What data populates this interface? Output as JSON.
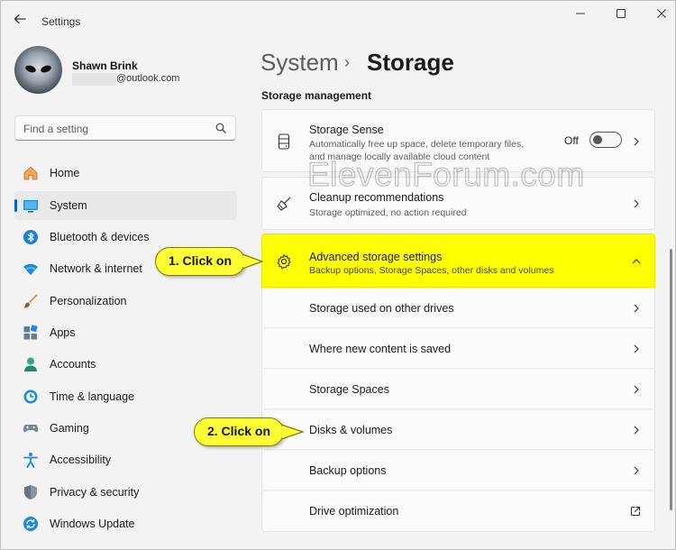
{
  "app": {
    "title": "Settings"
  },
  "window_controls": {
    "minimize": "—",
    "maximize": "☐",
    "close": "✕"
  },
  "user": {
    "name": "Shawn Brink",
    "email": "@outlook.com"
  },
  "search": {
    "placeholder": "Find a setting"
  },
  "nav": [
    {
      "label": "Home",
      "icon": "home-icon"
    },
    {
      "label": "System",
      "icon": "system-icon",
      "active": true
    },
    {
      "label": "Bluetooth & devices",
      "icon": "bluetooth-icon"
    },
    {
      "label": "Network & internet",
      "icon": "wifi-icon"
    },
    {
      "label": "Personalization",
      "icon": "brush-icon"
    },
    {
      "label": "Apps",
      "icon": "apps-icon"
    },
    {
      "label": "Accounts",
      "icon": "accounts-icon"
    },
    {
      "label": "Time & language",
      "icon": "clock-globe-icon"
    },
    {
      "label": "Gaming",
      "icon": "gamepad-icon"
    },
    {
      "label": "Accessibility",
      "icon": "accessibility-icon"
    },
    {
      "label": "Privacy & security",
      "icon": "shield-icon"
    },
    {
      "label": "Windows Update",
      "icon": "update-icon"
    }
  ],
  "breadcrumb": {
    "root": "System",
    "separator": "›",
    "current": "Storage"
  },
  "section_title": "Storage management",
  "storage_sense": {
    "title": "Storage Sense",
    "desc_line1": "Automatically free up space, delete temporary files,",
    "desc_line2": "and manage locally available cloud content",
    "toggle_label": "Off",
    "toggle_state": "off"
  },
  "cleanup": {
    "title": "Cleanup recommendations",
    "desc": "Storage optimized, no action required"
  },
  "advanced": {
    "title": "Advanced storage settings",
    "desc": "Backup options, Storage Spaces, other disks and volumes",
    "highlight_color": "#ffff00",
    "expanded": true
  },
  "sub_items": [
    {
      "label": "Storage used on other drives",
      "icon": "chevron-right-icon"
    },
    {
      "label": "Where new content is saved",
      "icon": "chevron-right-icon"
    },
    {
      "label": "Storage Spaces",
      "icon": "chevron-right-icon"
    },
    {
      "label": "Disks & volumes",
      "icon": "chevron-right-icon"
    },
    {
      "label": "Backup options",
      "icon": "chevron-right-icon"
    },
    {
      "label": "Drive optimization",
      "icon": "open-external-icon"
    }
  ],
  "callouts": {
    "step1": "1. Click on",
    "step2": "2. Click on"
  },
  "watermark": "ElevenForum.com",
  "colors": {
    "accent": "#0067c0",
    "callout": "#ffff33",
    "highlight": "#ffff00"
  }
}
